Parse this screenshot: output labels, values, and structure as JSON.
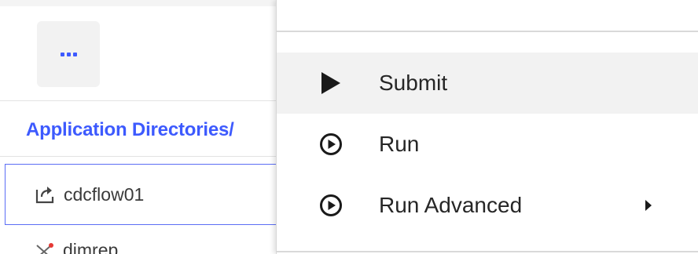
{
  "left_panel": {
    "more_button_icon": "more-horizontal-icon",
    "breadcrumb": "Application Directories/",
    "items": [
      {
        "label": "cdcflow01",
        "icon": "open-external-icon",
        "selected": true
      },
      {
        "label": "dimrep",
        "icon": "transform-x-icon",
        "selected": false
      }
    ]
  },
  "menu": {
    "items": [
      {
        "label": "Submit",
        "icon": "play-solid-icon",
        "highlighted": true,
        "has_submenu": false
      },
      {
        "label": "Run",
        "icon": "play-circle-icon",
        "highlighted": false,
        "has_submenu": false
      },
      {
        "label": "Run Advanced",
        "icon": "play-circle-icon",
        "highlighted": false,
        "has_submenu": true,
        "submenu_icon": "caret-right-icon"
      }
    ]
  },
  "colors": {
    "accent": "#3d5afe",
    "selected_border": "#5b6ef5",
    "menu_highlight": "#f2f2f2",
    "text": "#262626"
  }
}
